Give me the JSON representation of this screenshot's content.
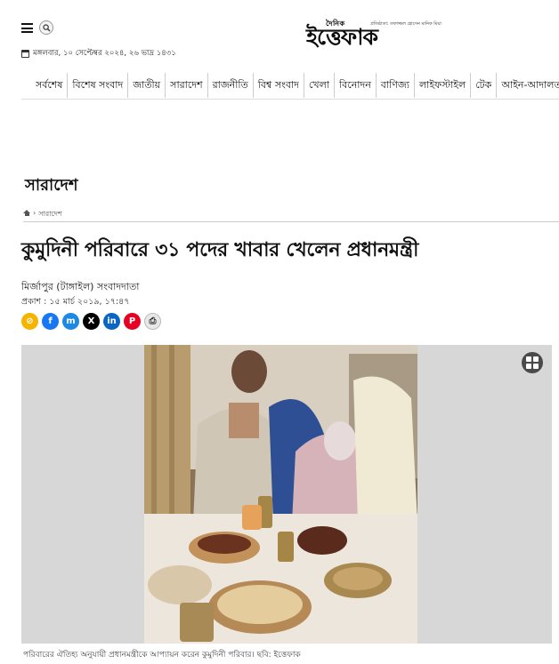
{
  "header": {
    "date": "মঙ্গলবার, ১০ সেপ্টেম্বর ২০২৪, ২৬ ভাদ্র ১৪৩১",
    "logo_small": "দৈনিক",
    "logo_main": "ইত্তেফাক",
    "logo_tagline": "প্রতিষ্ঠাতা: তফাজ্জল হোসেন মানিক মিয়া"
  },
  "nav": {
    "items": [
      "সর্বশেষ",
      "বিশেষ সংবাদ",
      "জাতীয়",
      "সারাদেশ",
      "রাজনীতি",
      "বিশ্ব সংবাদ",
      "খেলা",
      "বিনোদন",
      "বাণিজ্য",
      "লাইফস্টাইল",
      "টেক",
      "আইন-আদালত"
    ]
  },
  "section": {
    "title": "সারাদেশ"
  },
  "breadcrumb": {
    "current": "সারাদেশ"
  },
  "article": {
    "headline": "কুমুদিনী পরিবারে ৩১ পদের খাবার খেলেন প্রধানমন্ত্রী",
    "byline": "মির্জাপুর (টাঙ্গাইল) সংবাদদাতা",
    "published": "প্রকাশ : ১৫ মার্চ ২০১৯, ১৭:৪৭",
    "caption": "পরিবারের ঐতিহ্য অনুযায়ী প্রধানমন্ত্রীকে আপ্যায়ন করেন কুমুদিনী পরিবার। ছবি: ইত্তেফাক"
  },
  "share": [
    {
      "name": "copy-link-icon",
      "glyph": "⊘",
      "color": "#f5b400"
    },
    {
      "name": "facebook-icon",
      "glyph": "f",
      "color": "#1877f2"
    },
    {
      "name": "messenger-icon",
      "glyph": "m",
      "color": "#1e88e5"
    },
    {
      "name": "x-icon",
      "glyph": "X",
      "color": "#000000"
    },
    {
      "name": "linkedin-icon",
      "glyph": "in",
      "color": "#0a66c2"
    },
    {
      "name": "pinterest-icon",
      "glyph": "P",
      "color": "#e60023"
    },
    {
      "name": "print-icon",
      "glyph": "⎙",
      "color": "#e8e8e8"
    }
  ]
}
